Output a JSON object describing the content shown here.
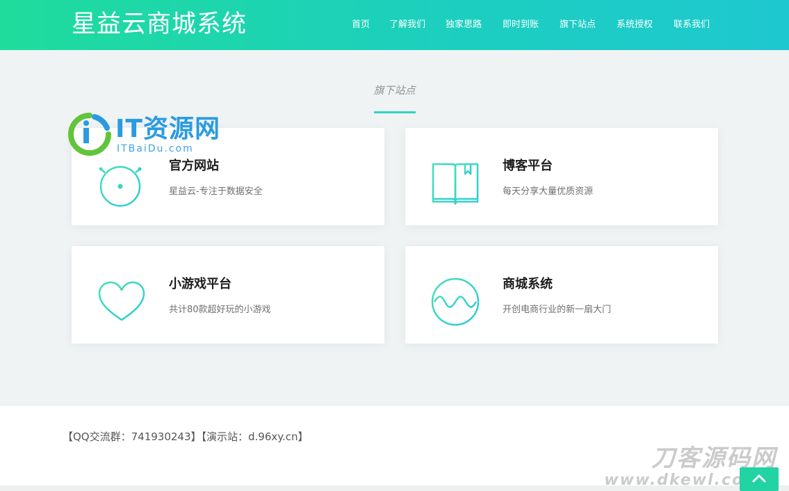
{
  "header": {
    "brand": "星益云商城系统",
    "nav": [
      "首页",
      "了解我们",
      "独家思路",
      "即时到账",
      "旗下站点",
      "系统授权",
      "联系我们"
    ]
  },
  "section": {
    "title": "旗下站点"
  },
  "cards": [
    {
      "title": "官方网站",
      "desc": "星益云-专注于数据安全",
      "icon": "stopwatch-icon"
    },
    {
      "title": "博客平台",
      "desc": "每天分享大量优质资源",
      "icon": "book-icon"
    },
    {
      "title": "小游戏平台",
      "desc": "共计80款超好玩的小游戏",
      "icon": "heart-icon"
    },
    {
      "title": "商城系统",
      "desc": "开创电商行业的新一扇大门",
      "icon": "wave-circle-icon"
    }
  ],
  "footer": {
    "text": "【QQ交流群：741930243】【演示站：d.96xy.cn】"
  },
  "watermarks": {
    "logo_text": "IT资源网",
    "logo_sub": "ITBaiDu.com",
    "bottom_text": "刀客源码网",
    "bottom_sub": "www.dkewl.com"
  },
  "colors": {
    "accent": "#2cd6c4",
    "header_start": "#1fdc9c",
    "header_end": "#1ec8d0"
  }
}
